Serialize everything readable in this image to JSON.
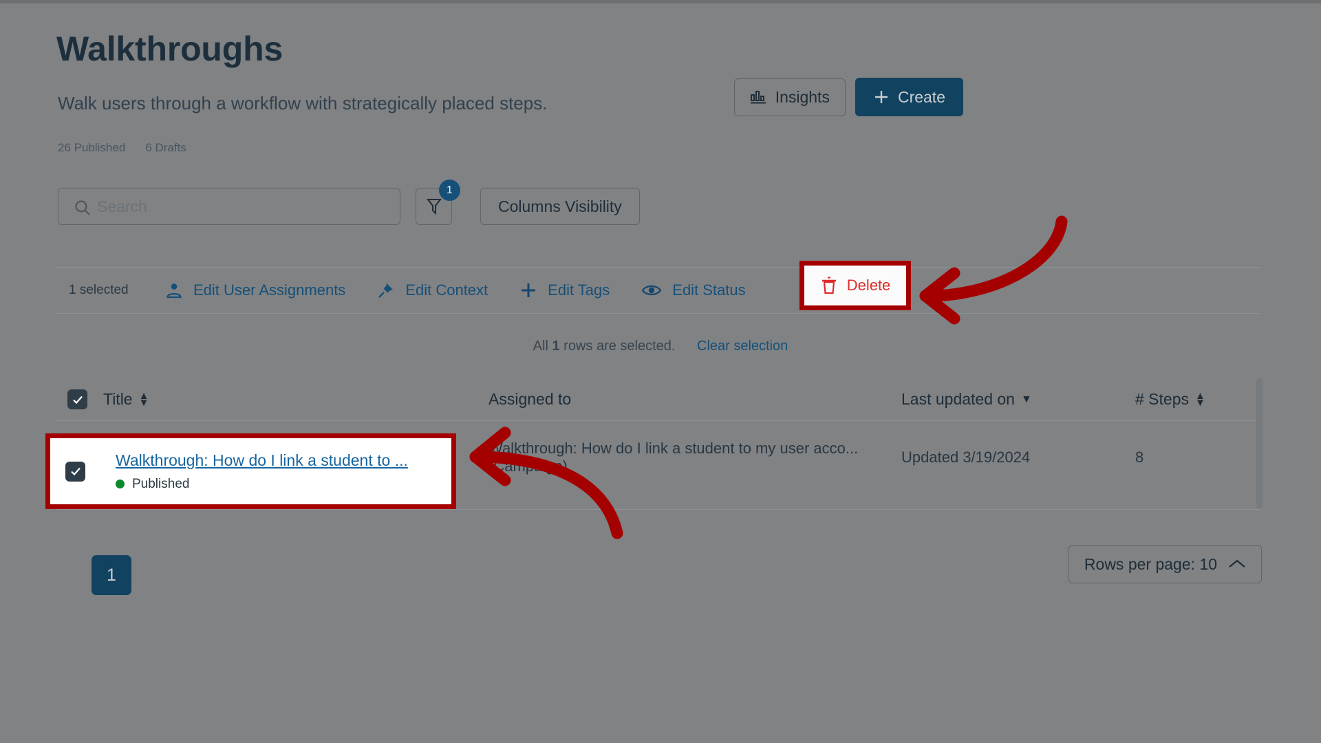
{
  "header": {
    "title": "Walkthroughs",
    "subtitle": "Walk users through a workflow with strategically placed steps.",
    "published_count": "26 Published",
    "drafts_count": "6 Drafts",
    "insights_label": "Insights",
    "create_label": "Create"
  },
  "toolbar": {
    "search_placeholder": "Search",
    "search_value": "",
    "filter_badge": "1",
    "columns_visibility_label": "Columns Visibility"
  },
  "bulk_actions": {
    "selected_text": "1 selected",
    "items": [
      {
        "label": "Edit User Assignments",
        "icon": "user-icon"
      },
      {
        "label": "Edit Context",
        "icon": "pin-icon"
      },
      {
        "label": "Edit Tags",
        "icon": "plus-icon"
      },
      {
        "label": "Edit Status",
        "icon": "eye-icon"
      },
      {
        "label": "Delete",
        "icon": "trash-icon"
      }
    ]
  },
  "selection_notice": {
    "prefix": "All",
    "count": "1",
    "suffix": "rows are selected.",
    "clear_label": "Clear selection"
  },
  "table": {
    "columns": [
      {
        "label": "Title",
        "sort": "both"
      },
      {
        "label": "Assigned to",
        "sort": "none"
      },
      {
        "label": "Last updated on",
        "sort": "desc"
      },
      {
        "label": "# Steps",
        "sort": "both"
      }
    ],
    "rows": [
      {
        "checked": true,
        "title": "Walkthrough: How do I link a student to ...",
        "status": "Published",
        "status_color": "#0a8a28",
        "assigned_to": "Walkthrough: How do I link a student to my user acco... (Campaign)",
        "last_updated": "Updated 3/19/2024",
        "steps": "8"
      }
    ]
  },
  "footer": {
    "current_page": "1",
    "rows_per_page_label": "Rows per page: 10"
  },
  "colors": {
    "brand_navy": "#11425f",
    "link_blue": "#155079",
    "danger_red": "#d8272c",
    "annotation_red": "#a50000",
    "status_green": "#0a8a28"
  }
}
